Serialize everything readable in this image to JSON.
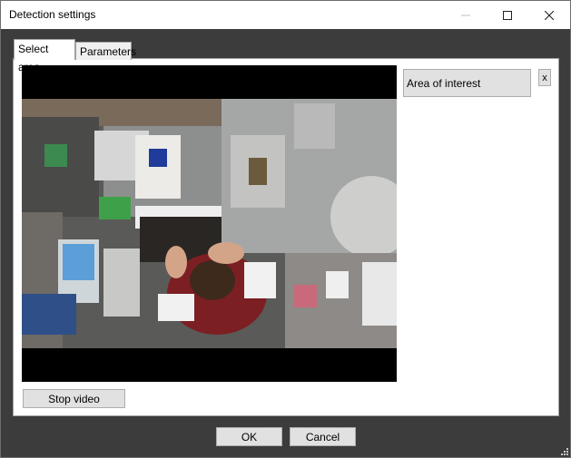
{
  "window": {
    "title": "Detection settings",
    "minimize_icon": "minimize-icon",
    "maximize_icon": "maximize-icon",
    "close_icon": "close-icon"
  },
  "tabs": [
    {
      "label": "Select area",
      "active": true
    },
    {
      "label": "Parameters",
      "active": false
    }
  ],
  "video": {
    "description_icon": "camera-feed"
  },
  "buttons": {
    "stop_video": "Stop video",
    "area_of_interest": "Area of interest",
    "remove_area": "x",
    "ok": "OK",
    "cancel": "Cancel"
  },
  "colors": {
    "window_frame": "#3c3c3c",
    "button_face": "#e1e1e1",
    "button_border": "#adadad"
  }
}
